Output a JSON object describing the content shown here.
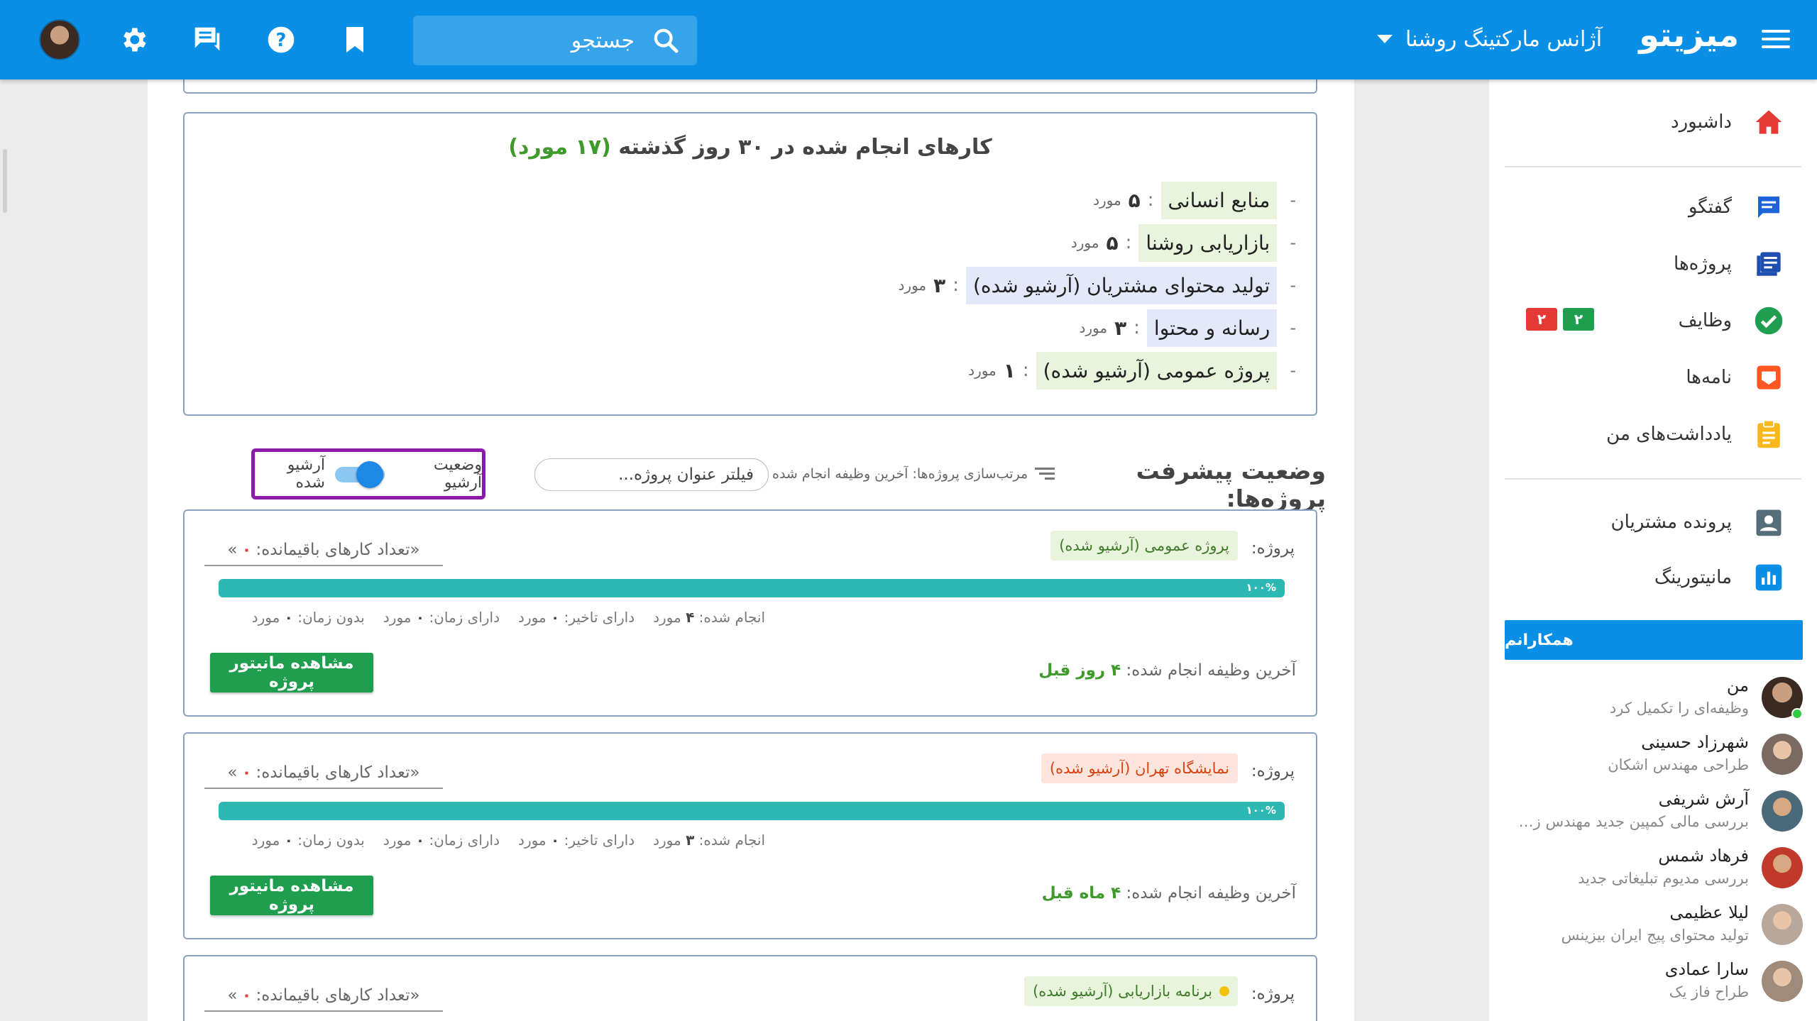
{
  "topbar": {
    "brand": "میزیتو",
    "org_name": "آژانس مارکتینگ روشنا",
    "search_placeholder": "جستجو",
    "icons": [
      "avatar",
      "gear-icon",
      "chat-icon",
      "help-icon",
      "bookmark-icon",
      "search-icon",
      "hamburger-icon"
    ]
  },
  "done_section": {
    "title": "کارهای انجام شده در ۳۰ روز گذشته",
    "total": "(۱۷ مورد)",
    "items": [
      {
        "name": "منابع انسانی",
        "count": "۵",
        "unit": "مورد",
        "color": "green"
      },
      {
        "name": "بازاریابی روشنا",
        "count": "۵",
        "unit": "مورد",
        "color": "green"
      },
      {
        "name": "تولید محتوای مشتریان (آرشیو شده)",
        "count": "۳",
        "unit": "مورد",
        "color": "blue"
      },
      {
        "name": "رسانه و محتوا",
        "count": "۳",
        "unit": "مورد",
        "color": "blue"
      },
      {
        "name": "پروژه عمومی (آرشیو شده)",
        "count": "۱",
        "unit": "مورد",
        "color": "green"
      }
    ]
  },
  "progress_section": {
    "title": "وضعیت پیشرفت پروژه‌ها:",
    "sort_label": "مرتب‌سازی پروژه‌ها: آخرین وظیفه انجام شده",
    "filter_placeholder": "فیلتر عنوان پروژه...",
    "archive_label": "وضعیت آرشیو",
    "archive_value": "آرشیو شده",
    "archive_on": true
  },
  "projects": [
    {
      "label": "پروژه:",
      "name": "پروژه عمومی (آرشیو شده)",
      "remaining_prefix": "«تعداد کارهای باقیمانده:",
      "remaining": "۰",
      "remaining_suffix": "»",
      "progress_pct": "۱۰۰%",
      "progress": 1.0,
      "stats": {
        "done_label": "انجام شده:",
        "done": "۴",
        "delayed_label": "دارای تاخیر:",
        "delayed": "۰",
        "timed_label": "دارای زمان:",
        "timed": "۰",
        "untimed_label": "بدون زمان:",
        "untimed": "۰",
        "unit": "مورد"
      },
      "last_label": "آخرین وظیفه انجام شده:",
      "last_ago": "۴ روز قبل",
      "button": "مشاهده مانیتور پروژه"
    },
    {
      "label": "پروژه:",
      "name": "نمایشگاه تهران (آرشیو شده)",
      "remaining_prefix": "«تعداد کارهای باقیمانده:",
      "remaining": "۰",
      "remaining_suffix": "»",
      "progress_pct": "۱۰۰%",
      "progress": 1.0,
      "stats": {
        "done_label": "انجام شده:",
        "done": "۳",
        "delayed_label": "دارای تاخیر:",
        "delayed": "۰",
        "timed_label": "دارای زمان:",
        "timed": "۰",
        "untimed_label": "بدون زمان:",
        "untimed": "۰",
        "unit": "مورد"
      },
      "last_label": "آخرین وظیفه انجام شده:",
      "last_ago": "۴ ماه قبل",
      "button": "مشاهده مانیتور پروژه"
    },
    {
      "label": "پروژه:",
      "name": "برنامه بازاریابی (آرشیو شده)",
      "remaining_prefix": "«تعداد کارهای باقیمانده:",
      "remaining": "۰",
      "remaining_suffix": "»"
    }
  ],
  "sidebar": {
    "items": [
      {
        "label": "داشبورد",
        "icon": "home-icon"
      },
      {
        "label": "گفتگو",
        "icon": "chat-icon"
      },
      {
        "label": "پروژه‌ها",
        "icon": "projects-icon"
      },
      {
        "label": "وظایف",
        "icon": "check-icon",
        "badge_green": "۲",
        "badge_red": "۲"
      },
      {
        "label": "نامه‌ها",
        "icon": "letter-icon"
      },
      {
        "label": "یادداشت‌های من",
        "icon": "clipboard-icon"
      },
      {
        "label": "پرونده مشتریان",
        "icon": "contact-icon"
      },
      {
        "label": "مانیتورینگ",
        "icon": "chart-icon"
      }
    ],
    "colleagues_title": "همکارانم",
    "colleagues": [
      {
        "name": "من",
        "desc": "وظیفه‌ای را تکمیل کرد"
      },
      {
        "name": "شهرزاد حسینی",
        "desc": "طراحی مهندس اشکان"
      },
      {
        "name": "آرش شریفی",
        "desc": "بررسی مالی کمپین جدید مهندس زیبایی"
      },
      {
        "name": "فرهاد شمس",
        "desc": "بررسی مدیوم تبلیغاتی جدید"
      },
      {
        "name": "لیلا عظیمی",
        "desc": "تولید محتوای پیج ایران بیزینس"
      },
      {
        "name": "سارا عمادی",
        "desc": "طراح فاز یک"
      }
    ]
  },
  "colors": {
    "topbar": "#0a8fe6",
    "accent_green": "#1e9e4e",
    "progress": "#2db8b3",
    "highlight_border": "#8c1aa8"
  }
}
